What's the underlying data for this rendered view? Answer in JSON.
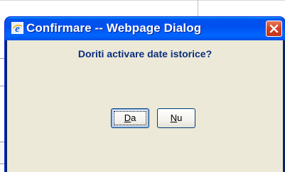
{
  "dialog": {
    "title": "Confirmare -- Webpage Dialog",
    "title_icon": "ie-icon",
    "close_icon": "close-icon",
    "message": "Doriti activare date istorice?",
    "buttons": {
      "yes": {
        "mnemonic": "D",
        "rest": "a"
      },
      "no": {
        "mnemonic": "N",
        "rest": "u"
      }
    },
    "default_button": "yes"
  },
  "colors": {
    "titlebar": "#0050ee",
    "body": "#ece9d8",
    "message_text": "#0b2d7e",
    "close_button": "#d44422"
  }
}
